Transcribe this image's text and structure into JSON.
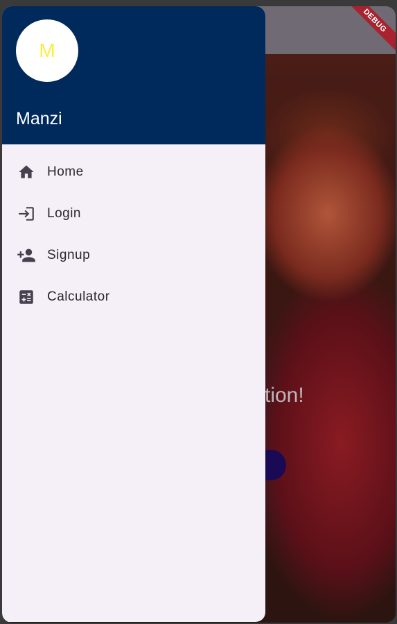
{
  "app": {
    "hero_text": "Your Solution!",
    "debug_banner": "DEBUG"
  },
  "drawer": {
    "avatar_initial": "M",
    "account_name": "Manzi",
    "items": [
      {
        "label": "Home",
        "icon": "home-icon"
      },
      {
        "label": "Login",
        "icon": "login-icon"
      },
      {
        "label": "Signup",
        "icon": "person-add-icon"
      },
      {
        "label": "Calculator",
        "icon": "calculate-icon"
      }
    ]
  },
  "colors": {
    "drawer_header": "#002a5c",
    "drawer_background": "#f5eff8",
    "avatar_text": "#ffeb3b",
    "debug_banner": "#a8232f"
  }
}
